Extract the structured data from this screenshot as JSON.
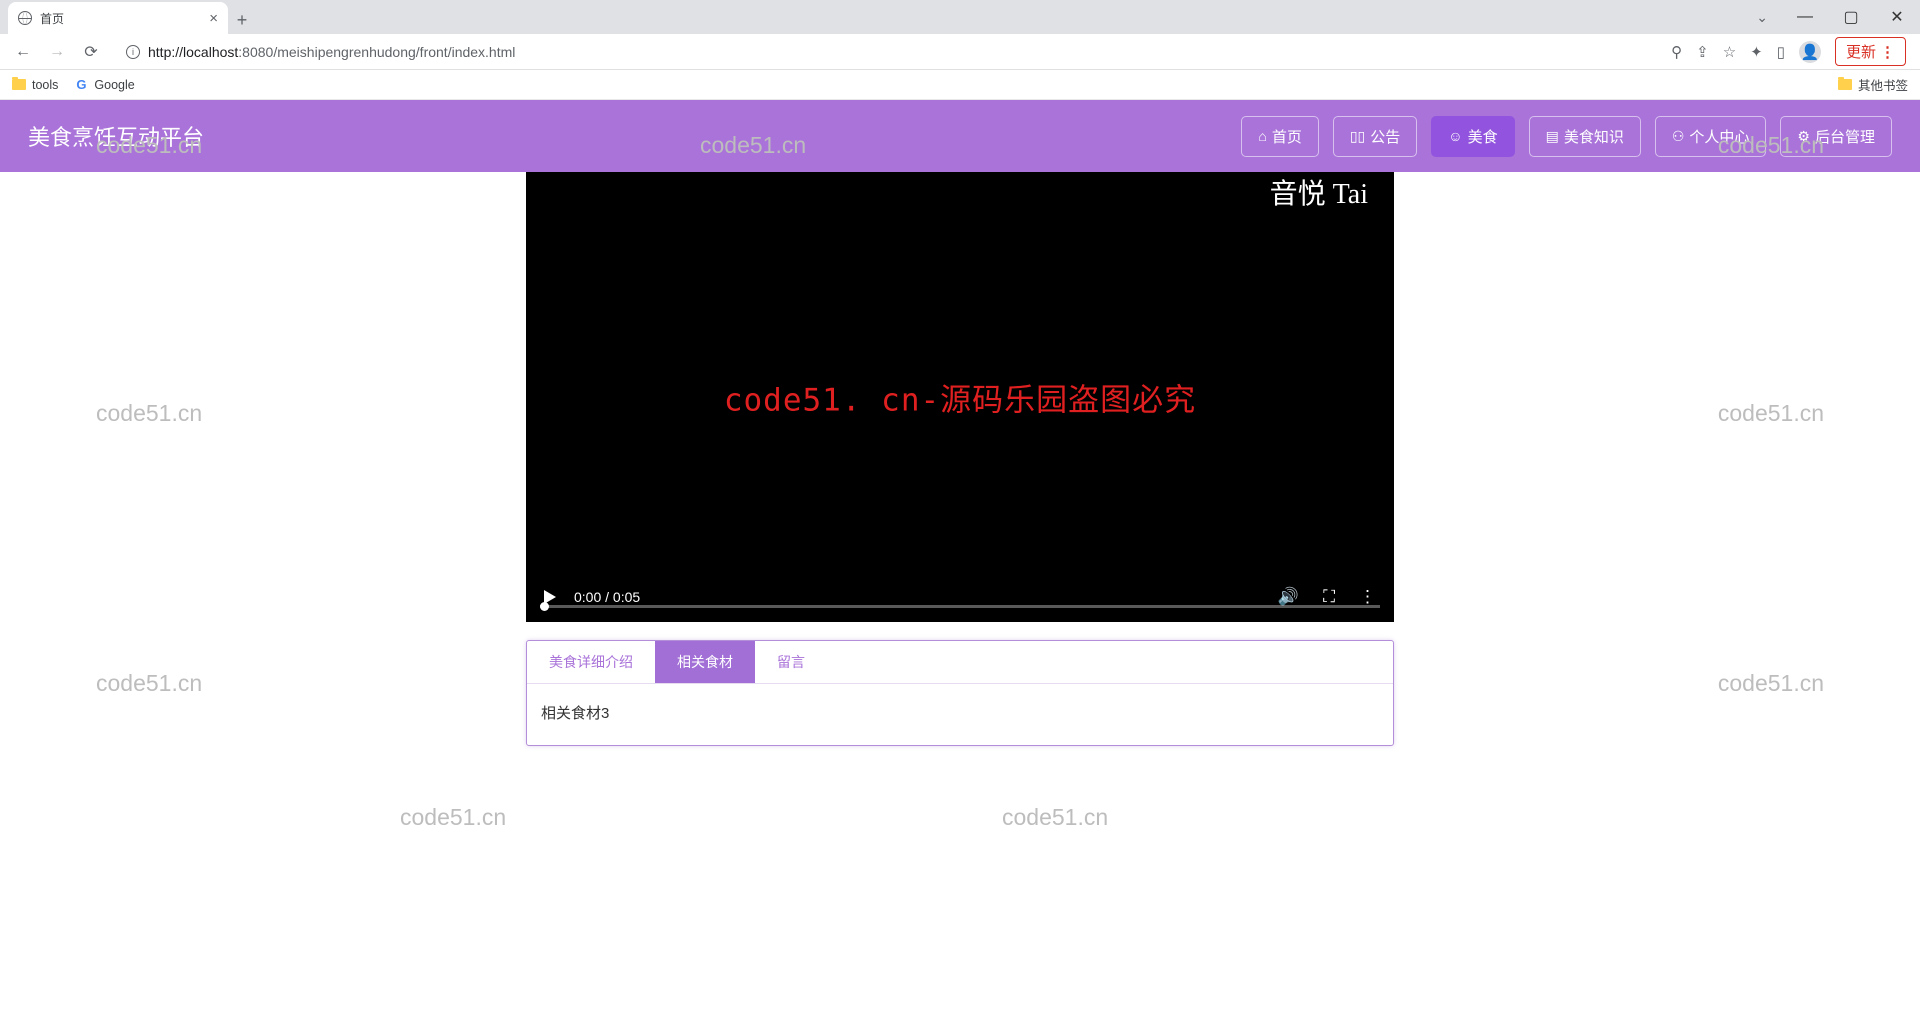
{
  "browser": {
    "tab_title": "首页",
    "url_host": "localhost",
    "url_port": ":8080",
    "url_path": "/meishipengrenhudong/front/index.html",
    "url_prefix": "http://",
    "update_label": "更新",
    "bookmarks": {
      "tools": "tools",
      "google": "Google",
      "other": "其他书签"
    }
  },
  "site": {
    "title": "美食烹饪互动平台",
    "nav": [
      {
        "icon": "⌂",
        "label": "首页",
        "active": false
      },
      {
        "icon": "▯▯",
        "label": "公告",
        "active": false
      },
      {
        "icon": "☺",
        "label": "美食",
        "active": true
      },
      {
        "icon": "▤",
        "label": "美食知识",
        "active": false
      },
      {
        "icon": "⚇",
        "label": "个人中心",
        "active": false
      },
      {
        "icon": "⚙",
        "label": "后台管理",
        "active": false
      }
    ]
  },
  "video": {
    "top_text": "音悦 Tai",
    "center_text": "code51. cn-源码乐园盗图必究",
    "time_current": "0:00",
    "time_total": "0:05"
  },
  "panel": {
    "tabs": [
      {
        "label": "美食详细介绍",
        "active": false
      },
      {
        "label": "相关食材",
        "active": true
      },
      {
        "label": "留言",
        "active": false
      }
    ],
    "body": "相关食材3"
  },
  "watermark": "code51.cn"
}
